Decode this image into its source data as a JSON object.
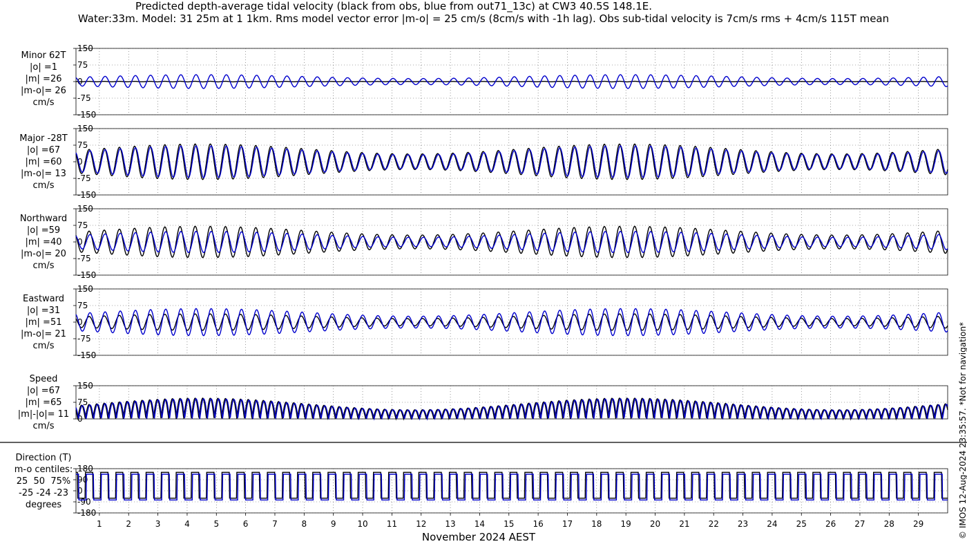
{
  "title_line1": "Predicted depth-average tidal velocity (black from obs, blue from out71_13c) at CW3 40.5S 148.1E.",
  "title_line2": "Water:33m. Model: 31 25m at 1 1km. Rms model vector error |m-o| = 25 cm/s (8cm/s with -1h lag). Obs sub-tidal velocity is 7cm/s rms + 4cm/s 115T mean",
  "xlabel": "November 2024 AEST",
  "credit": "© IMOS 12-Aug-2024 23:35:57. *Not for navigation*",
  "colors": {
    "obs": "#000000",
    "model": "#0000cc",
    "grid": "#555555"
  },
  "panel_labels": [
    "Minor 62T\n|o| =1\n|m| =26\n|m-o|= 26\ncm/s",
    "Major -28T\n|o| =67\n|m| =60\n|m-o|= 13\ncm/s",
    "Northward\n|o| =59\n|m| =40\n|m-o|= 20\ncm/s",
    "Eastward\n|o| =31\n|m| =51\n|m-o|= 21\ncm/s",
    "Speed\n|o| =67\n|m| =65\n|m|-|o|= 11\ncm/s",
    "Direction (T)\nm-o centiles:\n25  50  75%\n-25 -24 -23\ndegrees"
  ],
  "chart_data": {
    "type": "line",
    "x_domain": [
      0.2,
      30.0
    ],
    "x_ticks": [
      1,
      2,
      3,
      4,
      5,
      6,
      7,
      8,
      9,
      10,
      11,
      12,
      13,
      14,
      15,
      16,
      17,
      18,
      19,
      20,
      21,
      22,
      23,
      24,
      25,
      26,
      27,
      28,
      29
    ],
    "grid": true,
    "panels": [
      {
        "name": "Minor 62T",
        "ylim": [
          -150,
          150
        ],
        "yticks": [
          -150,
          -75,
          0,
          75,
          150
        ],
        "series": [
          {
            "key": "obs",
            "amp": 1
          },
          {
            "key": "model",
            "amp": 26
          }
        ]
      },
      {
        "name": "Major -28T",
        "ylim": [
          -150,
          150
        ],
        "yticks": [
          -150,
          -75,
          0,
          75,
          150
        ],
        "series": [
          {
            "key": "obs",
            "amp": 67
          },
          {
            "key": "model",
            "amp": 60
          }
        ]
      },
      {
        "name": "Northward",
        "ylim": [
          -150,
          150
        ],
        "yticks": [
          -150,
          -75,
          0,
          75,
          150
        ],
        "series": [
          {
            "key": "obs",
            "amp": 59
          },
          {
            "key": "model",
            "amp": 40
          }
        ]
      },
      {
        "name": "Eastward",
        "ylim": [
          -150,
          150
        ],
        "yticks": [
          -150,
          -75,
          0,
          75,
          150
        ],
        "series": [
          {
            "key": "obs",
            "amp": 31
          },
          {
            "key": "model",
            "amp": 51
          }
        ]
      },
      {
        "name": "Speed",
        "ylim": [
          0,
          150
        ],
        "yticks": [
          0,
          75,
          150
        ],
        "series": [
          {
            "key": "obs",
            "amp": 67
          },
          {
            "key": "model",
            "amp": 65
          }
        ]
      },
      {
        "name": "Direction (T)",
        "ylim": [
          -180,
          180
        ],
        "yticks": [
          -180,
          -90,
          0,
          90,
          180
        ],
        "series": [
          {
            "key": "obs",
            "levels": [
              150,
              -60
            ]
          },
          {
            "key": "model",
            "levels": [
              135,
              -75
            ]
          }
        ]
      }
    ]
  }
}
